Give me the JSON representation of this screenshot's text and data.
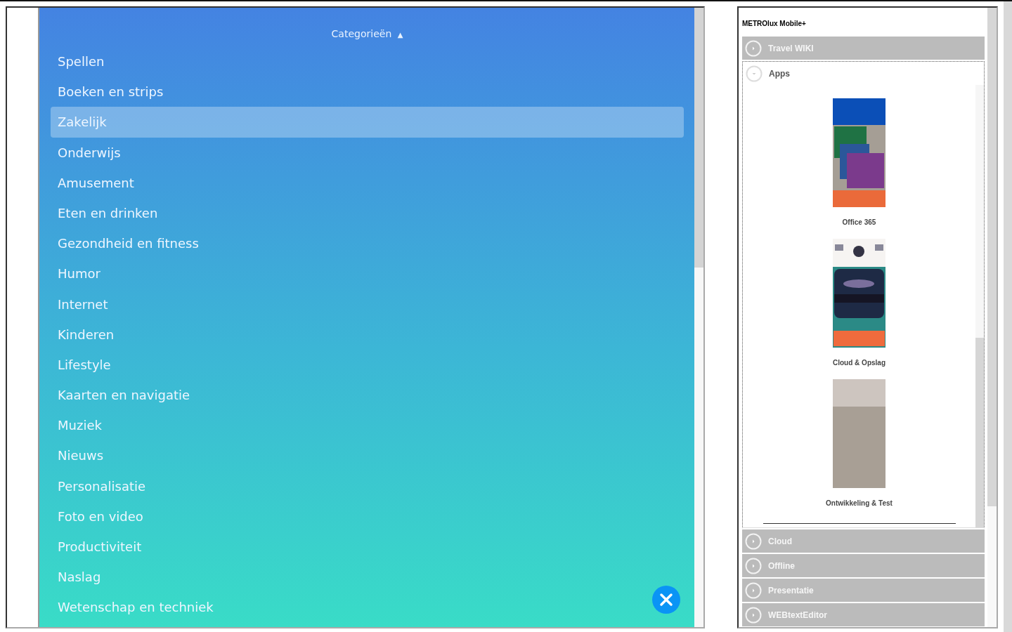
{
  "categories_panel": {
    "header": "Categorieën",
    "header_arrow": "▲",
    "categories": [
      {
        "label": "Spellen",
        "selected": false
      },
      {
        "label": "Boeken en strips",
        "selected": false
      },
      {
        "label": "Zakelijk",
        "selected": true
      },
      {
        "label": "Onderwijs",
        "selected": false
      },
      {
        "label": "Amusement",
        "selected": false
      },
      {
        "label": "Eten en drinken",
        "selected": false
      },
      {
        "label": "Gezondheid en fitness",
        "selected": false
      },
      {
        "label": "Humor",
        "selected": false
      },
      {
        "label": "Internet",
        "selected": false
      },
      {
        "label": "Kinderen",
        "selected": false
      },
      {
        "label": "Lifestyle",
        "selected": false
      },
      {
        "label": "Kaarten en navigatie",
        "selected": false
      },
      {
        "label": "Muziek",
        "selected": false
      },
      {
        "label": "Nieuws",
        "selected": false
      },
      {
        "label": "Personalisatie",
        "selected": false
      },
      {
        "label": "Foto en video",
        "selected": false
      },
      {
        "label": "Productiviteit",
        "selected": false
      },
      {
        "label": "Naslag",
        "selected": false
      },
      {
        "label": "Wetenschap en techniek",
        "selected": false
      }
    ]
  },
  "mobile_panel": {
    "title": "METROlux Mobile+",
    "sections": [
      {
        "label": "Travel WIKI",
        "expanded": false
      },
      {
        "label": "Apps",
        "expanded": true,
        "apps": [
          {
            "kind": "office",
            "label": "Office 365"
          },
          {
            "kind": "cloud",
            "label": "Cloud & Opslag"
          },
          {
            "kind": "plain",
            "label": "Ontwikkeling & Test"
          }
        ]
      },
      {
        "label": "Cloud",
        "expanded": false
      },
      {
        "label": "Offline",
        "expanded": false
      },
      {
        "label": "Presentatie",
        "expanded": false
      },
      {
        "label": "WEBtextEditor",
        "expanded": false
      }
    ]
  }
}
